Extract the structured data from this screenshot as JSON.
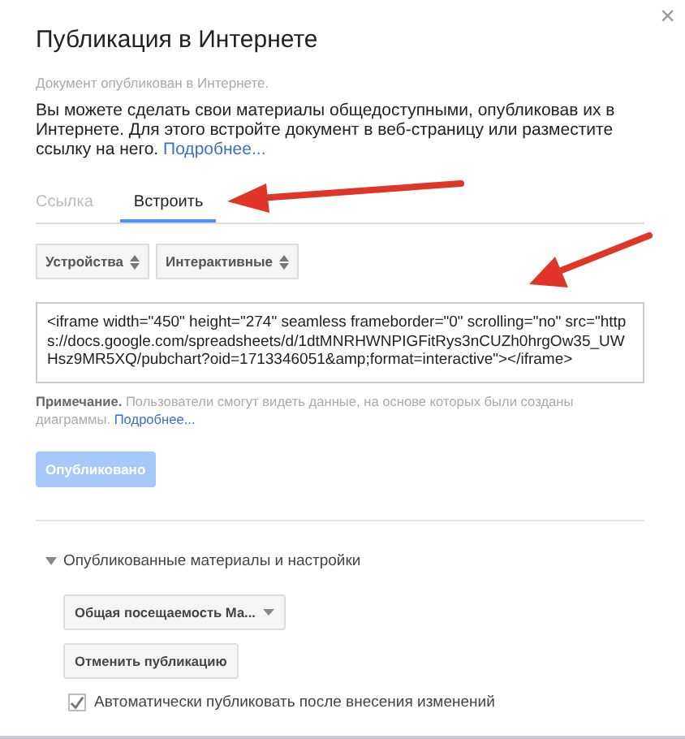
{
  "dialog": {
    "title": "Публикация в Интернете",
    "close": "×"
  },
  "status": "Документ опубликован в Интернете.",
  "description": {
    "text": "Вы можете сделать свои материалы общедоступными, опубликовав их в Интернете. Для этого встройте документ в веб-страницу или разместите ссылку на него.",
    "link": "Подробнее..."
  },
  "tabs": [
    {
      "label": "Ссылка",
      "selected": false
    },
    {
      "label": "Встроить",
      "selected": true
    }
  ],
  "selects": [
    "Устройства",
    "Интерактивные"
  ],
  "embed_code": "<iframe width=\"450\" height=\"274\" seamless frameborder=\"0\" scrolling=\"no\" src=\"https://docs.google.com/spreadsheets/d/1dtMNRHWNPIGFitRys3nCUZh0hrgOw35_UWHsz9MR5XQ/pubchart?oid=1713346051&amp;format=interactive\"></iframe>",
  "note": {
    "label": "Примечание.",
    "text": "Пользователи смогут видеть данные, на основе которых были созданы диаграммы.",
    "link": "Подробнее..."
  },
  "publish_button": {
    "label": "Опубликовано",
    "disabled": true
  },
  "published_section": {
    "title": "Опубликованные материалы и настройки",
    "expanded": true,
    "dropdown": "Общая посещаемость Ма...",
    "unpublish_button": "Отменить публикацию",
    "auto_publish": {
      "label": "Автоматически публиковать после внесения изменений",
      "checked": true
    }
  }
}
